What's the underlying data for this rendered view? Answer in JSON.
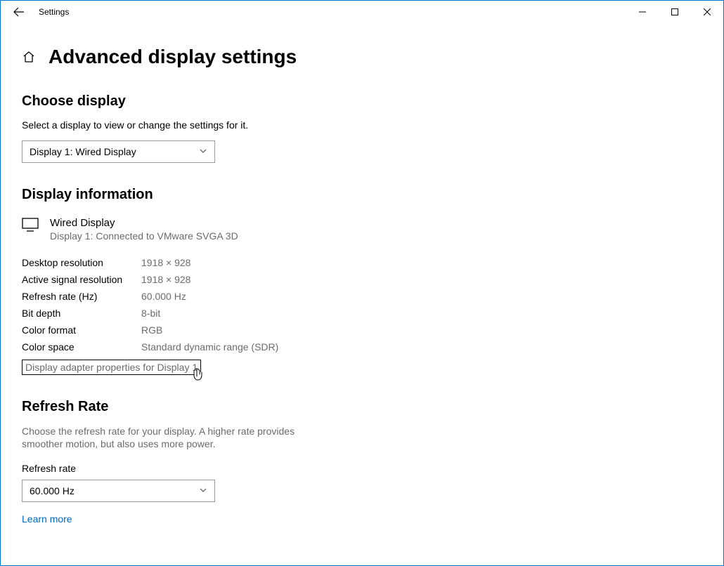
{
  "titlebar": {
    "app_name": "Settings"
  },
  "header": {
    "page_title": "Advanced display settings"
  },
  "choose_display": {
    "heading": "Choose display",
    "description": "Select a display to view or change the settings for it.",
    "selected": "Display 1: Wired Display"
  },
  "display_info": {
    "heading": "Display information",
    "display_name": "Wired Display",
    "display_sub": "Display 1: Connected to VMware SVGA 3D",
    "rows": [
      {
        "label": "Desktop resolution",
        "value": "1918 × 928"
      },
      {
        "label": "Active signal resolution",
        "value": "1918 × 928"
      },
      {
        "label": "Refresh rate (Hz)",
        "value": "60.000 Hz"
      },
      {
        "label": "Bit depth",
        "value": "8-bit"
      },
      {
        "label": "Color format",
        "value": "RGB"
      },
      {
        "label": "Color space",
        "value": "Standard dynamic range (SDR)"
      }
    ],
    "adapter_link": "Display adapter properties for Display 1"
  },
  "refresh_rate": {
    "heading": "Refresh Rate",
    "description": "Choose the refresh rate for your display. A higher rate provides smoother motion, but also uses more power.",
    "label": "Refresh rate",
    "selected": "60.000 Hz",
    "learn_more": "Learn more"
  }
}
